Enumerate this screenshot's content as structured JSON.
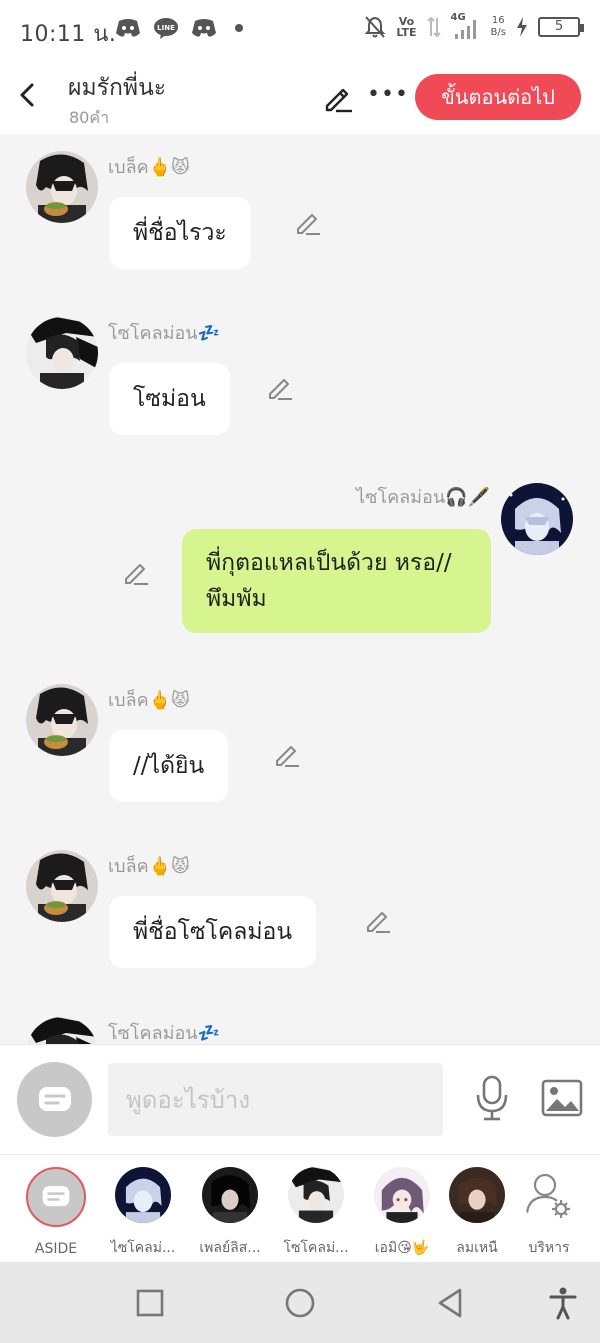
{
  "status_bar": {
    "time": "10:11 น.",
    "volte_top": "Vo",
    "volte_bottom": "LTE",
    "net_label": "4G",
    "speed_top": "16",
    "speed_bottom": "B/s",
    "battery": "5"
  },
  "header": {
    "title": "ผมรักพี่นะ",
    "word_count": "80คำ",
    "next_label": "ขั้นตอนต่อไป",
    "more_label": "•••"
  },
  "messages": [
    {
      "sender": "เบล็ค🖕😾",
      "text": "พี่ชื่อไรวะ",
      "mine": false
    },
    {
      "sender": "โซโคลม่อน💤",
      "text": "โซม่อน",
      "mine": false
    },
    {
      "sender": "ไซโคลม่อน🎧🖋️",
      "text": "พี่กุตอแหลเป็นด้วย หรอ//พึมพัม",
      "mine": true
    },
    {
      "sender": "เบล็ค🖕😾",
      "text": "//ได้ยิน",
      "mine": false
    },
    {
      "sender": "เบล็ค🖕😾",
      "text": "พี่ชื่อโซโคลม่อน",
      "mine": false
    },
    {
      "sender": "โซโคลม่อน💤",
      "text": "",
      "mine": false
    }
  ],
  "input": {
    "placeholder": "พูดอะไรบ้าง"
  },
  "participants": [
    {
      "label": "ASIDE"
    },
    {
      "label": "ไซโคลม่..."
    },
    {
      "label": "เพลย์ลิส..."
    },
    {
      "label": "โซโคลม่..."
    },
    {
      "label": "เอมิ😘🤟"
    },
    {
      "label": "ลมเหนื"
    },
    {
      "label": "บริหาร"
    }
  ],
  "colors": {
    "accent": "#f04a56",
    "my_bubble": "#d6f58f",
    "background": "#f4f4f4"
  },
  "icons": {
    "back": "chevron-left-icon",
    "edit": "pencil-icon",
    "mic": "microphone-icon",
    "image": "image-icon",
    "manage": "user-gear-icon"
  }
}
